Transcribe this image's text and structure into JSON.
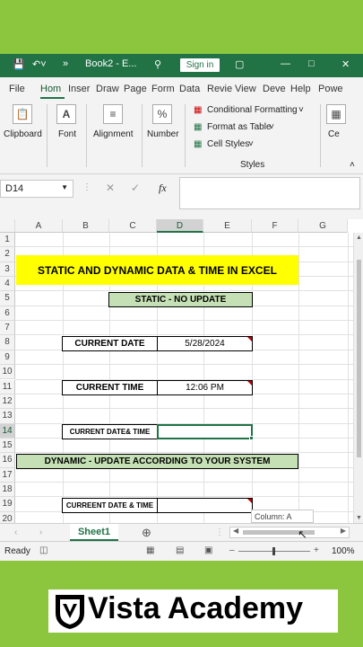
{
  "titlebar": {
    "filename": "Book2 - E...",
    "signin_label": "Sign in"
  },
  "menu": [
    "File",
    "Hom",
    "Inser",
    "Draw",
    "Page",
    "Form",
    "Data",
    "Revie",
    "View",
    "Deve",
    "Help",
    "Powe"
  ],
  "ribbon": {
    "clipboard": "Clipboard",
    "font": "Font",
    "alignment": "Alignment",
    "number": "Number",
    "conditional_formatting": "Conditional Formatting",
    "format_as_table": "Format as Table",
    "cell_styles": "Cell Styles",
    "styles_group": "Styles",
    "cells_partial": "Ce"
  },
  "formula_bar": {
    "name_box": "D14",
    "fx": "fx",
    "formula": ""
  },
  "columns": [
    "A",
    "B",
    "C",
    "D",
    "E",
    "F",
    "G"
  ],
  "rows": [
    "1",
    "2",
    "3",
    "4",
    "5",
    "6",
    "7",
    "8",
    "9",
    "10",
    "11",
    "12",
    "13",
    "14",
    "15",
    "16",
    "17",
    "18",
    "19",
    "20"
  ],
  "selected_cell": "D14",
  "cells": {
    "title": "STATIC AND DYNAMIC DATA & TIME IN EXCEL",
    "static_header": "STATIC - NO UPDATE",
    "current_date_label": "CURRENT DATE",
    "current_date_value": "5/28/2024",
    "current_time_label": "CURRENT TIME",
    "current_time_value": "12:06 PM",
    "current_datetime_label": "CURRENT DATE& TIME",
    "dynamic_header": "DYNAMIC - UPDATE ACCORDING TO YOUR SYSTEM",
    "current_datetime_label2": "CURREENT DATE & TIME"
  },
  "tooltip": "Column: A",
  "sheet_tab": "Sheet1",
  "status": {
    "ready": "Ready",
    "zoom": "100%"
  },
  "colors": {
    "excel_green": "#217346",
    "title_fill": "#ffff00",
    "header_fill": "#c5e0b4",
    "background": "#8cc63f"
  },
  "logo": {
    "text": "Vista Academy"
  }
}
